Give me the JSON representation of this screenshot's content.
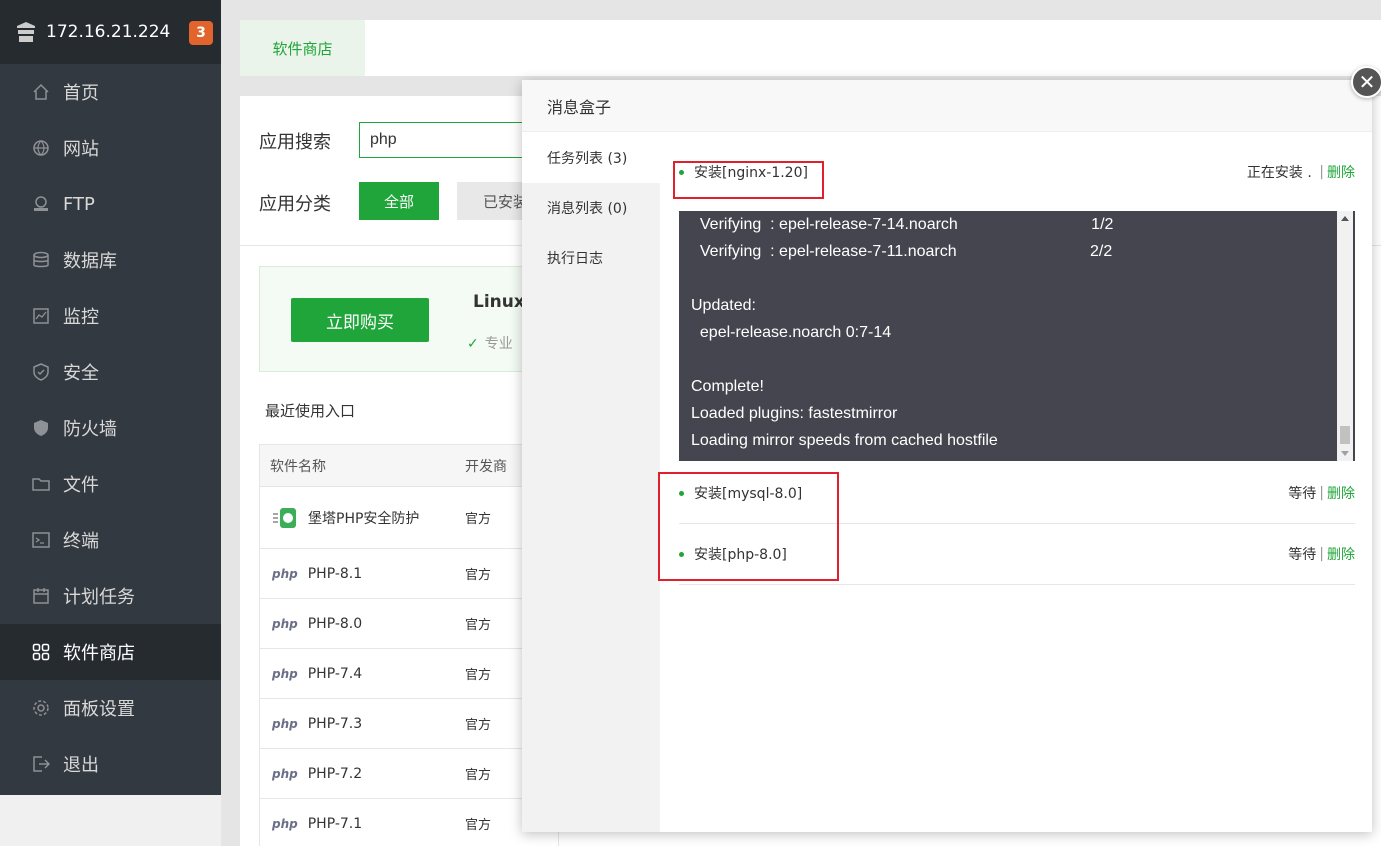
{
  "sidebar": {
    "host": "172.16.21.224",
    "badge": "3",
    "items": [
      {
        "label": "首页",
        "icon": "home-icon"
      },
      {
        "label": "网站",
        "icon": "globe-icon"
      },
      {
        "label": "FTP",
        "icon": "ftp-icon"
      },
      {
        "label": "数据库",
        "icon": "database-icon"
      },
      {
        "label": "监控",
        "icon": "monitor-icon"
      },
      {
        "label": "安全",
        "icon": "shield-check-icon"
      },
      {
        "label": "防火墙",
        "icon": "firewall-shield-icon"
      },
      {
        "label": "文件",
        "icon": "folder-icon"
      },
      {
        "label": "终端",
        "icon": "terminal-icon"
      },
      {
        "label": "计划任务",
        "icon": "calendar-icon"
      },
      {
        "label": "软件商店",
        "icon": "apps-grid-icon"
      },
      {
        "label": "面板设置",
        "icon": "gear-icon"
      },
      {
        "label": "退出",
        "icon": "logout-icon"
      }
    ]
  },
  "main": {
    "tab": "软件商店",
    "search_label": "应用搜索",
    "search_value": "php",
    "category_label": "应用分类",
    "cat_all": "全部",
    "cat_installed": "已安装",
    "buy_button": "立即购买",
    "promo_title": "Linux",
    "promo_check": "专业",
    "recent": "最近使用入口",
    "table": {
      "headers": [
        "软件名称",
        "开发商"
      ],
      "rows": [
        {
          "name": "堡塔PHP安全防护",
          "vendor": "官方"
        },
        {
          "name": "PHP-8.1",
          "vendor": "官方"
        },
        {
          "name": "PHP-8.0",
          "vendor": "官方"
        },
        {
          "name": "PHP-7.4",
          "vendor": "官方"
        },
        {
          "name": "PHP-7.3",
          "vendor": "官方"
        },
        {
          "name": "PHP-7.2",
          "vendor": "官方"
        },
        {
          "name": "PHP-7.1",
          "vendor": "官方"
        }
      ]
    }
  },
  "modal": {
    "title": "消息盒子",
    "side": [
      "任务列表 (3)",
      "消息列表 (0)",
      "执行日志"
    ],
    "tasks": [
      {
        "name": "安装[nginx-1.20]",
        "status": "正在安装 .",
        "delete": "删除"
      },
      {
        "name": "安装[mysql-8.0]",
        "status": "等待",
        "delete": "删除"
      },
      {
        "name": "安装[php-8.0]",
        "status": "等待",
        "delete": "删除"
      }
    ],
    "log": [
      "  Verifying  : epel-release-7-14.noarch                              1/2",
      "  Verifying  : epel-release-7-11.noarch                              2/2",
      "",
      "Updated:",
      "  epel-release.noarch 0:7-14",
      "",
      "Complete!",
      "Loaded plugins: fastestmirror",
      "Loading mirror speeds from cached hostfile"
    ]
  },
  "colors": {
    "accent": "#20a53a",
    "sidebar": "#333940",
    "highlight": "#e0202a"
  }
}
